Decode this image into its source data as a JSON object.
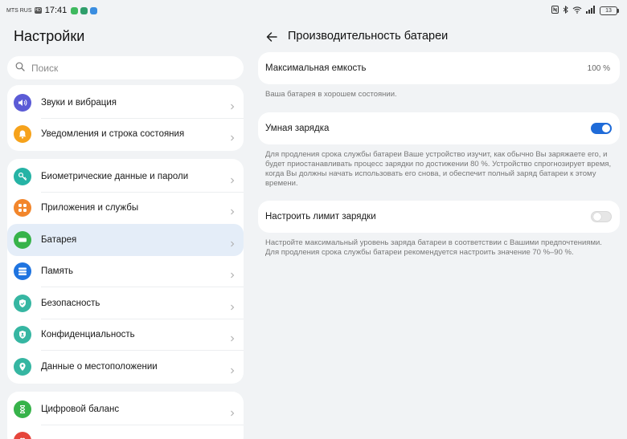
{
  "status_bar": {
    "carrier": "MTS RUS",
    "network_badge": "HD",
    "time": "17:41",
    "battery_level": "13",
    "app_icon_colors": [
      "#3fb95f",
      "#2f9e6b",
      "#3a8de0"
    ]
  },
  "settings": {
    "title": "Настройки",
    "search_placeholder": "Поиск",
    "groups": [
      {
        "items": [
          {
            "label": "Звуки и вибрация",
            "icon": "speaker-icon",
            "color": "#5b5bd6"
          },
          {
            "label": "Уведомления и строка состояния",
            "icon": "bell-icon",
            "color": "#f6a21b"
          }
        ]
      },
      {
        "items": [
          {
            "label": "Биометрические данные и пароли",
            "icon": "key-icon",
            "color": "#26b3a5"
          },
          {
            "label": "Приложения и службы",
            "icon": "apps-grid-icon",
            "color": "#f2862c"
          },
          {
            "label": "Батарея",
            "icon": "battery-icon",
            "color": "#37b34a",
            "active": true
          },
          {
            "label": "Память",
            "icon": "storage-icon",
            "color": "#1f74e0"
          },
          {
            "label": "Безопасность",
            "icon": "shield-check-icon",
            "color": "#36b6a2"
          },
          {
            "label": "Конфиденциальность",
            "icon": "privacy-shield-icon",
            "color": "#36b6a2"
          },
          {
            "label": "Данные о местоположении",
            "icon": "location-pin-icon",
            "color": "#36b6a2"
          }
        ]
      },
      {
        "items": [
          {
            "label": "Цифровой баланс",
            "icon": "hourglass-icon",
            "color": "#37b34a"
          },
          {
            "label": "",
            "icon": "huawei-icon",
            "color": "#e6453b"
          }
        ]
      }
    ]
  },
  "battery_performance": {
    "title": "Производительность батареи",
    "max_capacity": {
      "label": "Максимальная емкость",
      "value": "100 %"
    },
    "health_note": "Ваша батарея в хорошем состоянии.",
    "smart_charging": {
      "label": "Умная зарядка",
      "enabled": true
    },
    "smart_charging_note": "Для продления срока службы батареи Ваше устройство изучит, как обычно Вы заряжаете его, и будет приостанавливать процесс зарядки по достижении 80 %. Устройство спрогнозирует время, когда Вы должны начать использовать его снова, и обеспечит полный заряд батареи к этому времени.",
    "charge_limit": {
      "label": "Настроить лимит зарядки",
      "enabled": false
    },
    "charge_limit_note": "Настройте максимальный уровень заряда батареи в соответствии с Вашими предпочтениями. Для продления срока службы батареи рекомендуется настроить значение 70 %–90 %.",
    "accent_color": "#1f6bd8"
  }
}
